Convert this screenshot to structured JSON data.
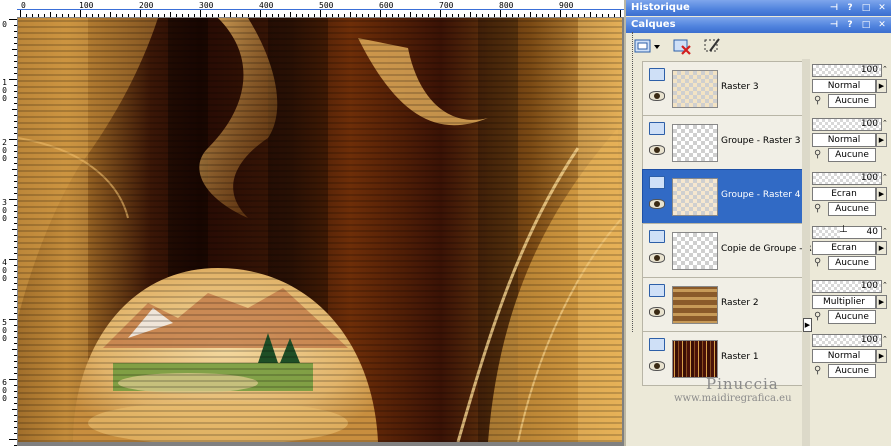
{
  "ruler": {
    "top_labels": [
      "0",
      "100",
      "200",
      "300",
      "400",
      "500",
      "600",
      "700",
      "800",
      "900"
    ],
    "left_labels": [
      "0",
      "1\n0\n0",
      "2\n0\n0",
      "3\n0\n0",
      "4\n0\n0",
      "5\n0\n0",
      "6\n0\n0"
    ]
  },
  "panels": {
    "history_title": "Historique",
    "layers_title": "Calques",
    "titlebar_buttons": [
      "⊣",
      "?",
      "□",
      "✕"
    ]
  },
  "layers": [
    {
      "name": "Raster 3",
      "opacity": "100",
      "blend": "Normal",
      "mask": "Aucune",
      "selected": false
    },
    {
      "name": "Groupe - Raster 3",
      "opacity": "100",
      "blend": "Normal",
      "mask": "Aucune",
      "selected": false
    },
    {
      "name": "Groupe - Raster 4",
      "opacity": "100",
      "blend": "Ecran",
      "mask": "Aucune",
      "selected": true
    },
    {
      "name": "Copie de Groupe - Ra",
      "opacity": "40",
      "blend": "Ecran",
      "mask": "Aucune",
      "selected": false
    },
    {
      "name": "Raster 2",
      "opacity": "100",
      "blend": "Multiplier",
      "mask": "Aucune",
      "selected": false
    },
    {
      "name": "Raster 1",
      "opacity": "100",
      "blend": "Normal",
      "mask": "Aucune",
      "selected": false
    }
  ],
  "watermark": {
    "name": "Pinuccia",
    "url": "www.maidiregrafica.eu"
  },
  "colors": {
    "titlebar": "#4f82dd",
    "selected_row": "#316ac5",
    "panel_bg": "#ece9d8"
  },
  "icons": {
    "toolbar": [
      "new-layer-icon",
      "delete-layer-icon",
      "mask-edit-icon"
    ],
    "row": [
      "layer-visibility-icon",
      "eye-icon",
      "layer-thumbnail"
    ]
  }
}
